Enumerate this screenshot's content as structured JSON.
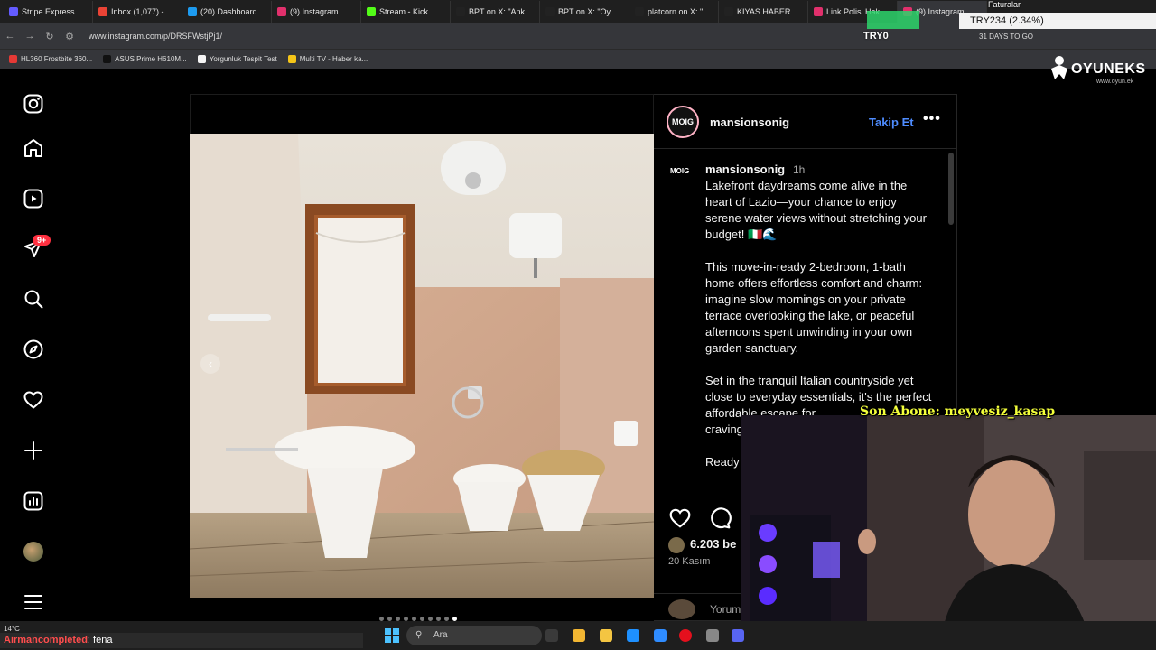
{
  "browser": {
    "tabs": [
      {
        "label": "Stripe Express",
        "color": "#635bff"
      },
      {
        "label": "Inbox (1,077) - kickta",
        "color": "#ea4335"
      },
      {
        "label": "(20) Dashboard / Stre",
        "color": "#1d9bf0"
      },
      {
        "label": "(9) Instagram",
        "color": "#e1306c"
      },
      {
        "label": "Stream - Kick Dashbo",
        "color": "#53fc18"
      },
      {
        "label": "BPT on X: \"Ankara'da",
        "color": "#222222"
      },
      {
        "label": "BPT on X: \"Oyunculu",
        "color": "#222222"
      },
      {
        "label": "platcorn on X: \"YouTu",
        "color": "#222222"
      },
      {
        "label": "KIYAS HABER on X: \"E",
        "color": "#222222"
      },
      {
        "label": "Link Polisi Hakat v1.0",
        "color": "#e1306c"
      },
      {
        "label": "(9) Instagram",
        "color": "#e1306c"
      }
    ],
    "url": "www.instagram.com/p/DRSFWstjPj1/",
    "bookmarks": [
      {
        "label": "HL360 Frostbite 360...",
        "color": "#e53935"
      },
      {
        "label": "ASUS Prime H610M...",
        "color": "#111111"
      },
      {
        "label": "Yorgunluk Tespit Test",
        "color": "#f5f5f5"
      },
      {
        "label": "Multi TV - Haber ka...",
        "color": "#f5c518"
      }
    ]
  },
  "overlay": {
    "faturalar": "Faturalar",
    "ticker": "TRY234 (2.34%)",
    "try0": "TRY0",
    "days_to_go": "31 DAYS TO GO",
    "brand": "OYUNEKS",
    "brand_sub": "www.oyun.ek",
    "last_subscriber": "Son Abone: meyvesiz_kasap"
  },
  "sidebar": {
    "notification_badge": "9+"
  },
  "post": {
    "account_avatar_text": "MOIG",
    "username": "mansionsonig",
    "follow_label": "Takip Et",
    "more_label": "•••",
    "time": "1h",
    "caption": "Lakefront daydreams come alive in the heart of Lazio—your chance to enjoy serene water views without stretching your budget! 🇮🇹🌊\n\nThis move-in-ready 2-bedroom, 1-bath home offers effortless comfort and charm: imagine slow mornings on your private terrace overlooking the lake, or peaceful afternoons spent unwinding in your own garden sanctuary.\n\nSet in the tranquil Italian countryside yet close to everyday essentials, it's the perfect affordable escape for\ncraving\n\nReady",
    "likes": "6.203 be",
    "date": "20 Kasım",
    "comment_placeholder": "Yorum",
    "carousel_dots": 10,
    "carousel_active": 9
  },
  "taskbar": {
    "weather": "14°C",
    "search_placeholder": "Ara",
    "chat_user": "Airmancompleted",
    "chat_message": ": fena"
  }
}
